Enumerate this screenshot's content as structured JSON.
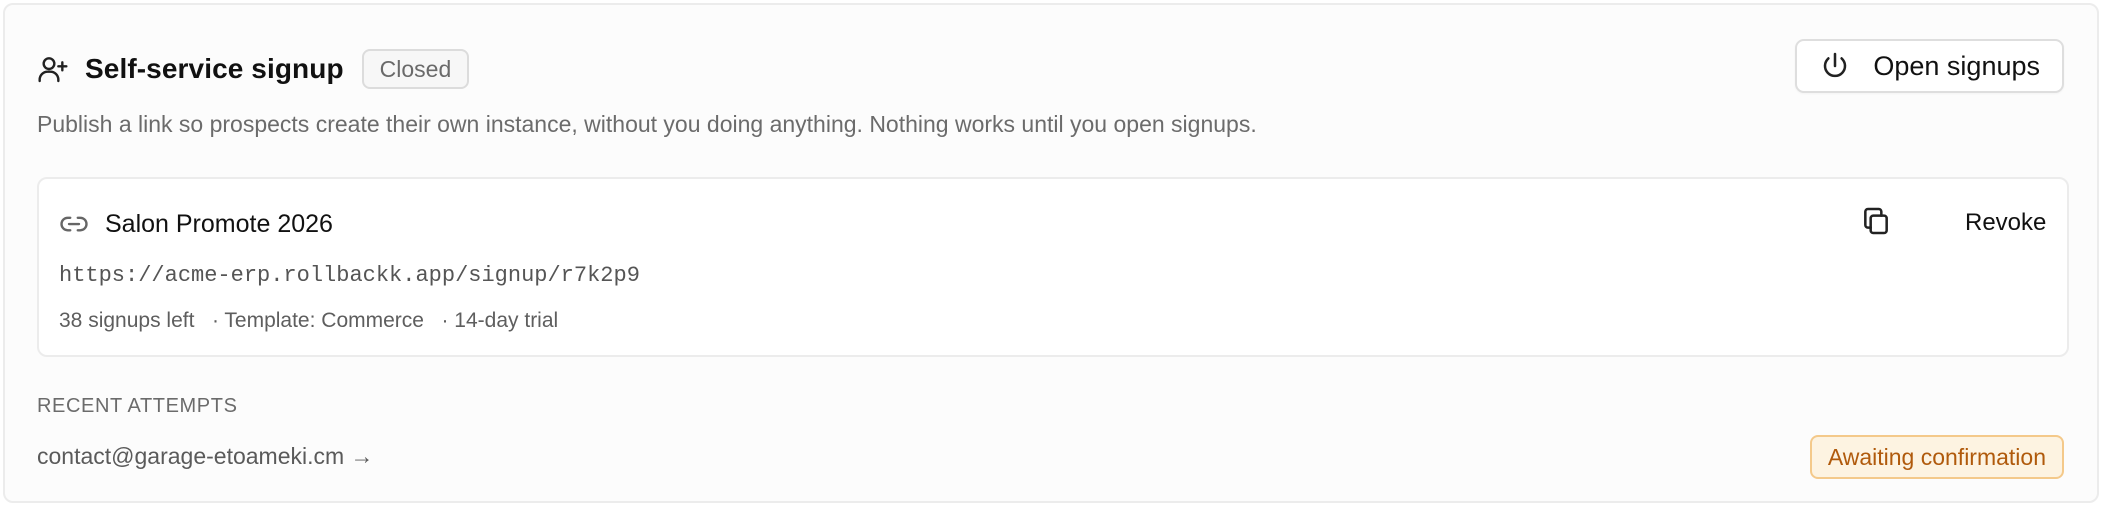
{
  "header": {
    "title": "Self-service signup",
    "status": "Closed",
    "icon": "user-plus-icon",
    "open_button_label": "Open signups",
    "open_button_icon": "power-icon"
  },
  "description": "Publish a link so prospects create their own instance, without you doing anything. Nothing works until you open signups.",
  "invite": {
    "name": "Salon Promote 2026",
    "url": "https://acme-erp.rollbackk.app/signup/r7k2p9",
    "signups_left": "38 signups left",
    "template": "· Template: Commerce",
    "trial": "· 14-day trial",
    "copy_icon": "copy-icon",
    "revoke_label": "Revoke"
  },
  "recent_attempts": {
    "title": "RECENT ATTEMPTS",
    "items": [
      {
        "email": "contact@garage-etoameki.cm →",
        "status": "Awaiting confirmation"
      }
    ]
  },
  "colors": {
    "badge_warning_bg": "#fdf3e1",
    "badge_warning_border": "#f4c98a",
    "badge_warning_text": "#b05a0c"
  }
}
